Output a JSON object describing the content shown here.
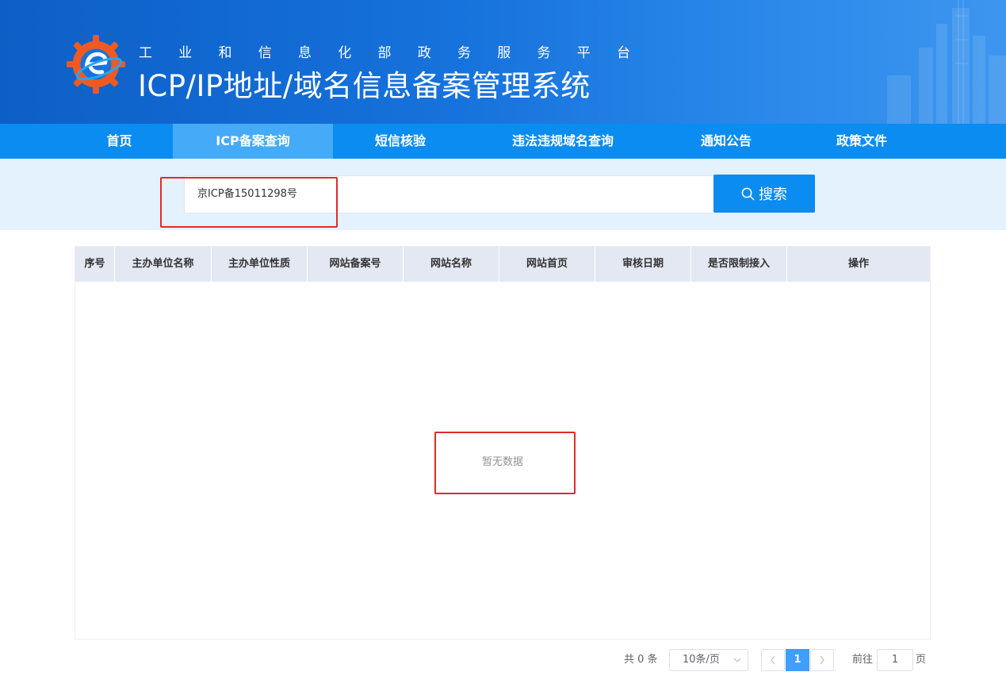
{
  "header": {
    "subtitle_chars": [
      "工",
      "业",
      "和",
      "信",
      "息",
      "化",
      "部",
      "政",
      "务",
      "服",
      "务",
      "平",
      "台"
    ],
    "title": "ICP/IP地址/域名信息备案管理系统"
  },
  "nav": {
    "items": [
      {
        "label": "首页",
        "active": false
      },
      {
        "label": "ICP备案查询",
        "active": true
      },
      {
        "label": "短信核验",
        "active": false
      },
      {
        "label": "违法违规域名查询",
        "active": false
      },
      {
        "label": "通知公告",
        "active": false
      },
      {
        "label": "政策文件",
        "active": false
      }
    ]
  },
  "search": {
    "value": "京ICP备15011298号",
    "button_label": "搜索"
  },
  "table": {
    "columns": [
      "序号",
      "主办单位名称",
      "主办单位性质",
      "网站备案号",
      "网站名称",
      "网站首页",
      "审核日期",
      "是否限制接入",
      "操作"
    ],
    "empty_text": "暂无数据"
  },
  "pagination": {
    "total": "共 0 条",
    "page_size": "10条/页",
    "current_page": "1",
    "goto_prefix": "前往",
    "goto_value": "1",
    "goto_suffix": "页"
  },
  "colors": {
    "header_blue": "#1672dc",
    "nav_blue": "#0a8cf0",
    "nav_active": "#45aaf7",
    "search_band": "#e4f2fd",
    "highlight_red": "#e32a2a",
    "page_active": "#409eff"
  }
}
